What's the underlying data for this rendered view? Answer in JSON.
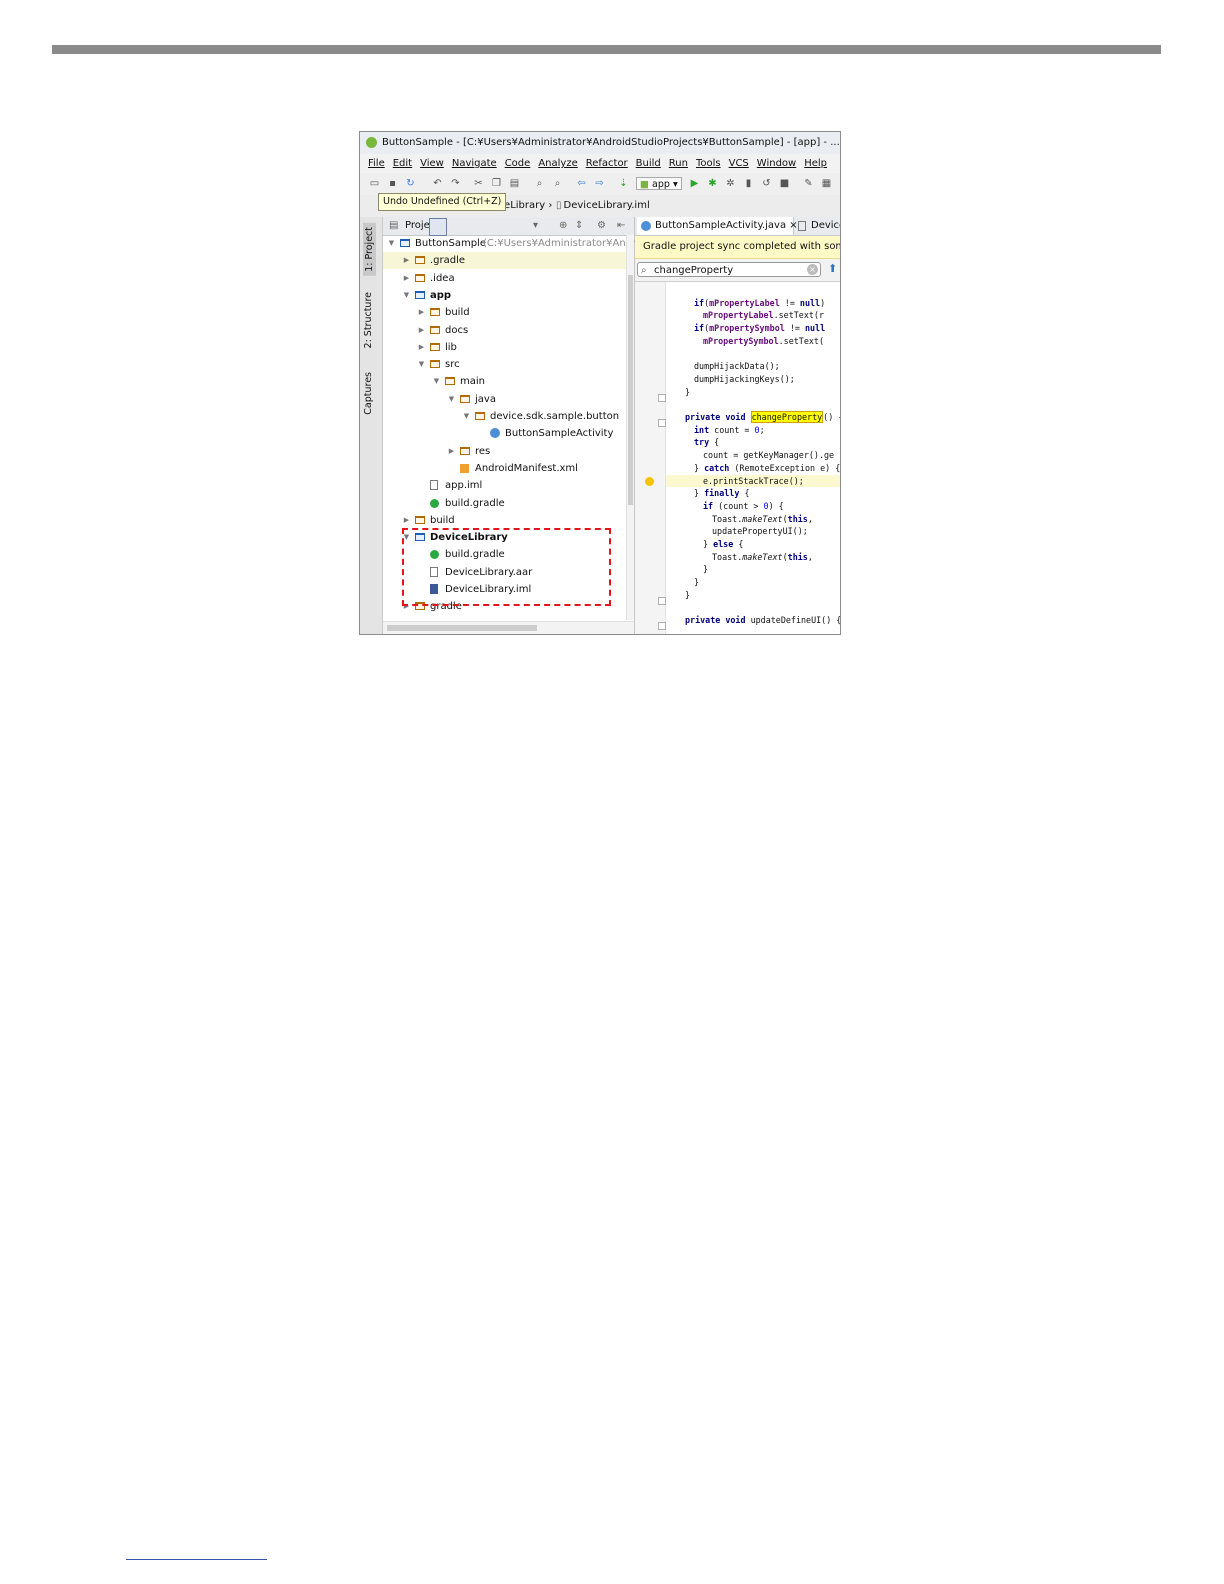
{
  "window": {
    "title": "ButtonSample - [C:¥Users¥Administrator¥AndroidStudioProjects¥ButtonSample] - [app] - ...¥app¥src¥"
  },
  "menu": [
    "File",
    "Edit",
    "View",
    "Navigate",
    "Code",
    "Analyze",
    "Refactor",
    "Build",
    "Run",
    "Tools",
    "VCS",
    "Window",
    "Help"
  ],
  "toolbar": {
    "run_config": "app",
    "tooltip": "Undo Undefined (Ctrl+Z)"
  },
  "navbar": {
    "crumbs": [
      "DeviceLibrary",
      "DeviceLibrary.iml"
    ]
  },
  "side_tabs": [
    "1: Project",
    "2: Structure",
    "Captures"
  ],
  "project_panel": {
    "header": "Project",
    "root_path_hint": "(C:¥Users¥Administrator¥Androic",
    "tree": [
      {
        "label": "ButtonSample",
        "depth": 0,
        "icon": "module",
        "arrow": "down",
        "bold": false
      },
      {
        "label": ".gradle",
        "depth": 1,
        "icon": "folder",
        "arrow": "right"
      },
      {
        "label": ".idea",
        "depth": 1,
        "icon": "folder",
        "arrow": "right"
      },
      {
        "label": "app",
        "depth": 1,
        "icon": "module",
        "arrow": "down",
        "bold": true
      },
      {
        "label": "build",
        "depth": 2,
        "icon": "folder",
        "arrow": "right"
      },
      {
        "label": "docs",
        "depth": 2,
        "icon": "folder",
        "arrow": "right"
      },
      {
        "label": "lib",
        "depth": 2,
        "icon": "folder",
        "arrow": "right"
      },
      {
        "label": "src",
        "depth": 2,
        "icon": "folder",
        "arrow": "down"
      },
      {
        "label": "main",
        "depth": 3,
        "icon": "folder",
        "arrow": "down"
      },
      {
        "label": "java",
        "depth": 4,
        "icon": "source-folder",
        "arrow": "down"
      },
      {
        "label": "device.sdk.sample.button",
        "depth": 5,
        "icon": "package",
        "arrow": "down"
      },
      {
        "label": "ButtonSampleActivity",
        "depth": 6,
        "icon": "class",
        "arrow": ""
      },
      {
        "label": "res",
        "depth": 4,
        "icon": "folder",
        "arrow": "right"
      },
      {
        "label": "AndroidManifest.xml",
        "depth": 4,
        "icon": "xml",
        "arrow": ""
      },
      {
        "label": "app.iml",
        "depth": 2,
        "icon": "file",
        "arrow": ""
      },
      {
        "label": "build.gradle",
        "depth": 2,
        "icon": "gradle",
        "arrow": ""
      },
      {
        "label": "build",
        "depth": 1,
        "icon": "folder",
        "arrow": "right"
      },
      {
        "label": "DeviceLibrary",
        "depth": 1,
        "icon": "module",
        "arrow": "down",
        "bold": true
      },
      {
        "label": "build.gradle",
        "depth": 2,
        "icon": "gradle",
        "arrow": ""
      },
      {
        "label": "DeviceLibrary.aar",
        "depth": 2,
        "icon": "file",
        "arrow": ""
      },
      {
        "label": "DeviceLibrary.iml",
        "depth": 2,
        "icon": "iml",
        "arrow": ""
      },
      {
        "label": "gradle",
        "depth": 1,
        "icon": "folder",
        "arrow": "right"
      }
    ]
  },
  "editor": {
    "tabs": [
      "ButtonSampleActivity.java",
      "Device"
    ],
    "sync_message": "Gradle project sync completed with some er",
    "search_value": "changeProperty",
    "code_lines": [
      {
        "html": "",
        "blank": true
      },
      {
        "indent": 4,
        "tokens": [
          [
            "kw",
            "if"
          ],
          [
            "",
            "("
          ],
          [
            "fld",
            "mPropertyLabel"
          ],
          [
            "",
            " != "
          ],
          [
            "kw",
            "null"
          ],
          [
            "",
            ")"
          ]
        ]
      },
      {
        "indent": 6,
        "tokens": [
          [
            "fld",
            "mPropertyLabel"
          ],
          [
            "",
            ".setText(r"
          ]
        ]
      },
      {
        "indent": 4,
        "tokens": [
          [
            "kw",
            "if"
          ],
          [
            "",
            "("
          ],
          [
            "fld",
            "mPropertySymbol"
          ],
          [
            "",
            " != "
          ],
          [
            "kw",
            "null"
          ]
        ]
      },
      {
        "indent": 6,
        "tokens": [
          [
            "fld",
            "mPropertySymbol"
          ],
          [
            "",
            ".setText("
          ]
        ]
      },
      {
        "blank": true
      },
      {
        "indent": 4,
        "tokens": [
          [
            "",
            "dumpHijackData();"
          ]
        ]
      },
      {
        "indent": 4,
        "tokens": [
          [
            "",
            "dumpHijackingKeys();"
          ]
        ]
      },
      {
        "indent": 2,
        "tokens": [
          [
            "",
            "}"
          ]
        ]
      },
      {
        "blank": true
      },
      {
        "indent": 2,
        "tokens": [
          [
            "kw",
            "private void "
          ],
          [
            "match",
            "changeProperty"
          ],
          [
            "",
            "() {"
          ]
        ]
      },
      {
        "indent": 4,
        "tokens": [
          [
            "kw",
            "int "
          ],
          [
            "",
            "count = "
          ],
          [
            "num",
            "0"
          ],
          [
            "",
            ";"
          ]
        ]
      },
      {
        "indent": 4,
        "tokens": [
          [
            "kw",
            "try "
          ],
          [
            "",
            "{"
          ]
        ]
      },
      {
        "indent": 6,
        "tokens": [
          [
            "",
            "count = getKeyManager().ge"
          ]
        ]
      },
      {
        "indent": 4,
        "tokens": [
          [
            "",
            "} "
          ],
          [
            "kw",
            "catch "
          ],
          [
            "",
            "(RemoteException e) {"
          ]
        ]
      },
      {
        "indent": 6,
        "tokens": [
          [
            "",
            "e.printStackTrace();"
          ]
        ],
        "highlight": true
      },
      {
        "indent": 4,
        "tokens": [
          [
            "",
            "} "
          ],
          [
            "kw",
            "finally "
          ],
          [
            "",
            "{"
          ]
        ]
      },
      {
        "indent": 6,
        "tokens": [
          [
            "kw",
            "if "
          ],
          [
            "",
            "(count > "
          ],
          [
            "num",
            "0"
          ],
          [
            "",
            ") {"
          ]
        ]
      },
      {
        "indent": 8,
        "tokens": [
          [
            "",
            "Toast."
          ],
          [
            "ital",
            "makeText"
          ],
          [
            "",
            "("
          ],
          [
            "kw",
            "this"
          ],
          [
            "",
            ", "
          ]
        ]
      },
      {
        "indent": 8,
        "tokens": [
          [
            "",
            "updatePropertyUI();"
          ]
        ]
      },
      {
        "indent": 6,
        "tokens": [
          [
            "",
            "} "
          ],
          [
            "kw",
            "else "
          ],
          [
            "",
            "{"
          ]
        ]
      },
      {
        "indent": 8,
        "tokens": [
          [
            "",
            "Toast."
          ],
          [
            "ital",
            "makeText"
          ],
          [
            "",
            "("
          ],
          [
            "kw",
            "this"
          ],
          [
            "",
            ", "
          ]
        ]
      },
      {
        "indent": 6,
        "tokens": [
          [
            "",
            "}"
          ]
        ]
      },
      {
        "indent": 4,
        "tokens": [
          [
            "",
            "}"
          ]
        ]
      },
      {
        "indent": 2,
        "tokens": [
          [
            "",
            "}"
          ]
        ]
      },
      {
        "blank": true
      },
      {
        "indent": 2,
        "tokens": [
          [
            "kw",
            "private void "
          ],
          [
            "",
            "updateDefineUI() {"
          ]
        ]
      }
    ]
  }
}
